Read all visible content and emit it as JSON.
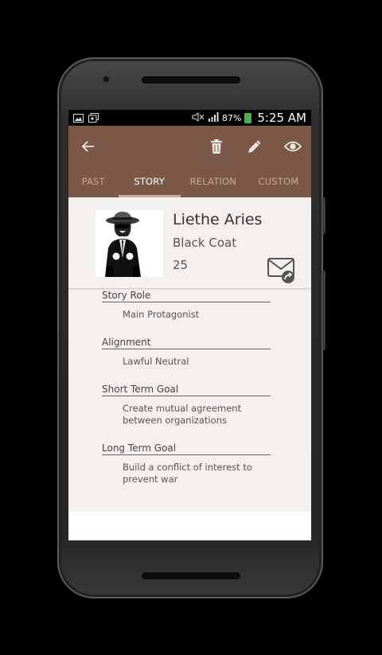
{
  "statusbar": {
    "battery": "87%",
    "time": "5:25 AM"
  },
  "appbar": {
    "icons": [
      "back-arrow-icon",
      "trash-icon",
      "pencil-icon",
      "eye-icon"
    ],
    "tabs": [
      "PAST",
      "STORY",
      "RELATION",
      "CUSTOM"
    ],
    "active_tab": "STORY",
    "color": "#7b5847"
  },
  "profile": {
    "name": "Liethe Aries",
    "alias": "Black Coat",
    "age": "25"
  },
  "fields": [
    {
      "label": "Story Role",
      "value": "Main Protagonist"
    },
    {
      "label": "Alignment",
      "value": "Lawful Neutral"
    },
    {
      "label": "Short Term Goal",
      "value": "Create mutual agreement between organizations"
    },
    {
      "label": "Long Term Goal",
      "value": "Build a conflict of interest to prevent war"
    }
  ]
}
